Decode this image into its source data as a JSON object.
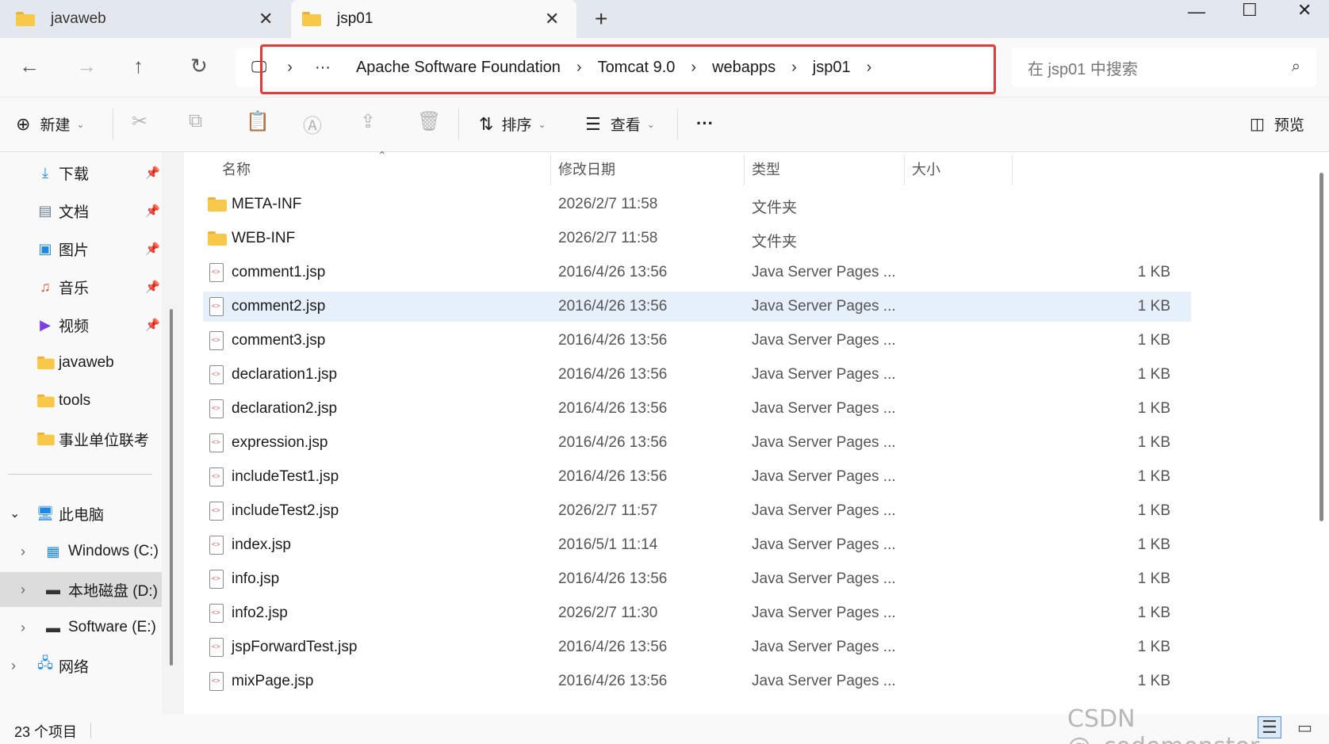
{
  "tabs": [
    {
      "label": "javaweb",
      "active": false
    },
    {
      "label": "jsp01",
      "active": true
    }
  ],
  "address": {
    "overflow": "···",
    "segments": [
      "Apache Software Foundation",
      "Tomcat 9.0",
      "webapps",
      "jsp01"
    ]
  },
  "search": {
    "placeholder": "在 jsp01 中搜索"
  },
  "toolbar": {
    "new_label": "新建",
    "sort_label": "排序",
    "view_label": "查看",
    "more_label": "···",
    "preview_label": "预览"
  },
  "sidebar": {
    "quick": [
      {
        "label": "下载",
        "icon": "download-icon",
        "pinned": true
      },
      {
        "label": "文档",
        "icon": "document-icon",
        "pinned": true
      },
      {
        "label": "图片",
        "icon": "pictures-icon",
        "pinned": true
      },
      {
        "label": "音乐",
        "icon": "music-icon",
        "pinned": true
      },
      {
        "label": "视频",
        "icon": "video-icon",
        "pinned": true
      },
      {
        "label": "javaweb",
        "icon": "folder-icon",
        "pinned": false
      },
      {
        "label": "tools",
        "icon": "folder-icon",
        "pinned": false
      },
      {
        "label": "事业单位联考",
        "icon": "folder-icon",
        "pinned": false
      }
    ],
    "thispc": "此电脑",
    "drives": [
      "Windows (C:)",
      "本地磁盘 (D:)",
      "Software (E:)"
    ],
    "network": "网络"
  },
  "columns": {
    "name": "名称",
    "date": "修改日期",
    "type": "类型",
    "size": "大小"
  },
  "files": [
    {
      "name": "META-INF",
      "date": "2026/2/7 11:58",
      "type": "文件夹",
      "size": "",
      "kind": "folder"
    },
    {
      "name": "WEB-INF",
      "date": "2026/2/7 11:58",
      "type": "文件夹",
      "size": "",
      "kind": "folder"
    },
    {
      "name": "comment1.jsp",
      "date": "2016/4/26 13:56",
      "type": "Java Server Pages ...",
      "size": "1 KB",
      "kind": "jsp"
    },
    {
      "name": "comment2.jsp",
      "date": "2016/4/26 13:56",
      "type": "Java Server Pages ...",
      "size": "1 KB",
      "kind": "jsp"
    },
    {
      "name": "comment3.jsp",
      "date": "2016/4/26 13:56",
      "type": "Java Server Pages ...",
      "size": "1 KB",
      "kind": "jsp"
    },
    {
      "name": "declaration1.jsp",
      "date": "2016/4/26 13:56",
      "type": "Java Server Pages ...",
      "size": "1 KB",
      "kind": "jsp"
    },
    {
      "name": "declaration2.jsp",
      "date": "2016/4/26 13:56",
      "type": "Java Server Pages ...",
      "size": "1 KB",
      "kind": "jsp"
    },
    {
      "name": "expression.jsp",
      "date": "2016/4/26 13:56",
      "type": "Java Server Pages ...",
      "size": "1 KB",
      "kind": "jsp"
    },
    {
      "name": "includeTest1.jsp",
      "date": "2016/4/26 13:56",
      "type": "Java Server Pages ...",
      "size": "1 KB",
      "kind": "jsp"
    },
    {
      "name": "includeTest2.jsp",
      "date": "2026/2/7 11:57",
      "type": "Java Server Pages ...",
      "size": "1 KB",
      "kind": "jsp"
    },
    {
      "name": "index.jsp",
      "date": "2016/5/1 11:14",
      "type": "Java Server Pages ...",
      "size": "1 KB",
      "kind": "jsp"
    },
    {
      "name": "info.jsp",
      "date": "2016/4/26 13:56",
      "type": "Java Server Pages ...",
      "size": "1 KB",
      "kind": "jsp"
    },
    {
      "name": "info2.jsp",
      "date": "2026/2/7 11:30",
      "type": "Java Server Pages ...",
      "size": "1 KB",
      "kind": "jsp"
    },
    {
      "name": "jspForwardTest.jsp",
      "date": "2016/4/26 13:56",
      "type": "Java Server Pages ...",
      "size": "1 KB",
      "kind": "jsp"
    },
    {
      "name": "mixPage.jsp",
      "date": "2016/4/26 13:56",
      "type": "Java Server Pages ...",
      "size": "1 KB",
      "kind": "jsp"
    }
  ],
  "selected_file": "comment2.jsp",
  "status": {
    "count": "23 个项目"
  },
  "watermark": "CSDN @_codemonster"
}
